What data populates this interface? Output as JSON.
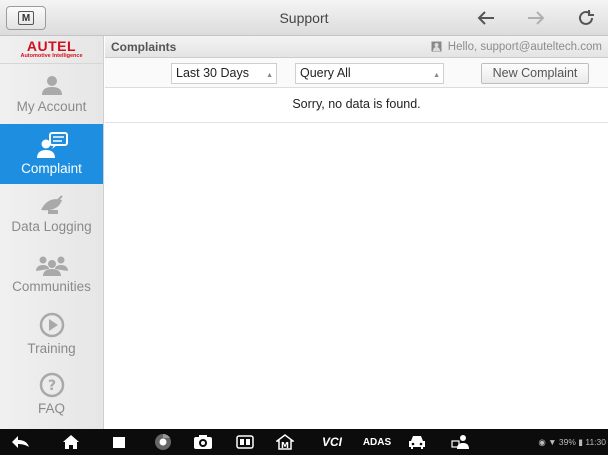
{
  "window": {
    "title": "Support",
    "home_icon": "home-m-icon"
  },
  "sidebar": {
    "brand": "AUTEL",
    "tagline": "Automotive Intelligence",
    "items": [
      {
        "label": "My Account",
        "icon": "user-icon",
        "active": false
      },
      {
        "label": "Complaint",
        "icon": "chat-user-icon",
        "active": true
      },
      {
        "label": "Data Logging",
        "icon": "satellite-dish-icon",
        "active": false
      },
      {
        "label": "Communities",
        "icon": "group-icon",
        "active": false
      },
      {
        "label": "Training",
        "icon": "play-icon",
        "active": false
      },
      {
        "label": "FAQ",
        "icon": "question-icon",
        "active": false
      }
    ]
  },
  "main": {
    "section_title": "Complaints",
    "greeting": "Hello, support@auteltech.com",
    "filters": {
      "period": "Last 30 Days",
      "query": "Query All",
      "new_button": "New Complaint"
    },
    "empty_message": "Sorry, no data is found."
  },
  "colors": {
    "accent": "#1d8ee0",
    "brand": "#d2101d",
    "taskbar": "#0c0c0c"
  },
  "taskbar": {
    "vci_label": "VCI",
    "adas_label": "ADAS",
    "status": "39%",
    "clock": "11:30"
  }
}
